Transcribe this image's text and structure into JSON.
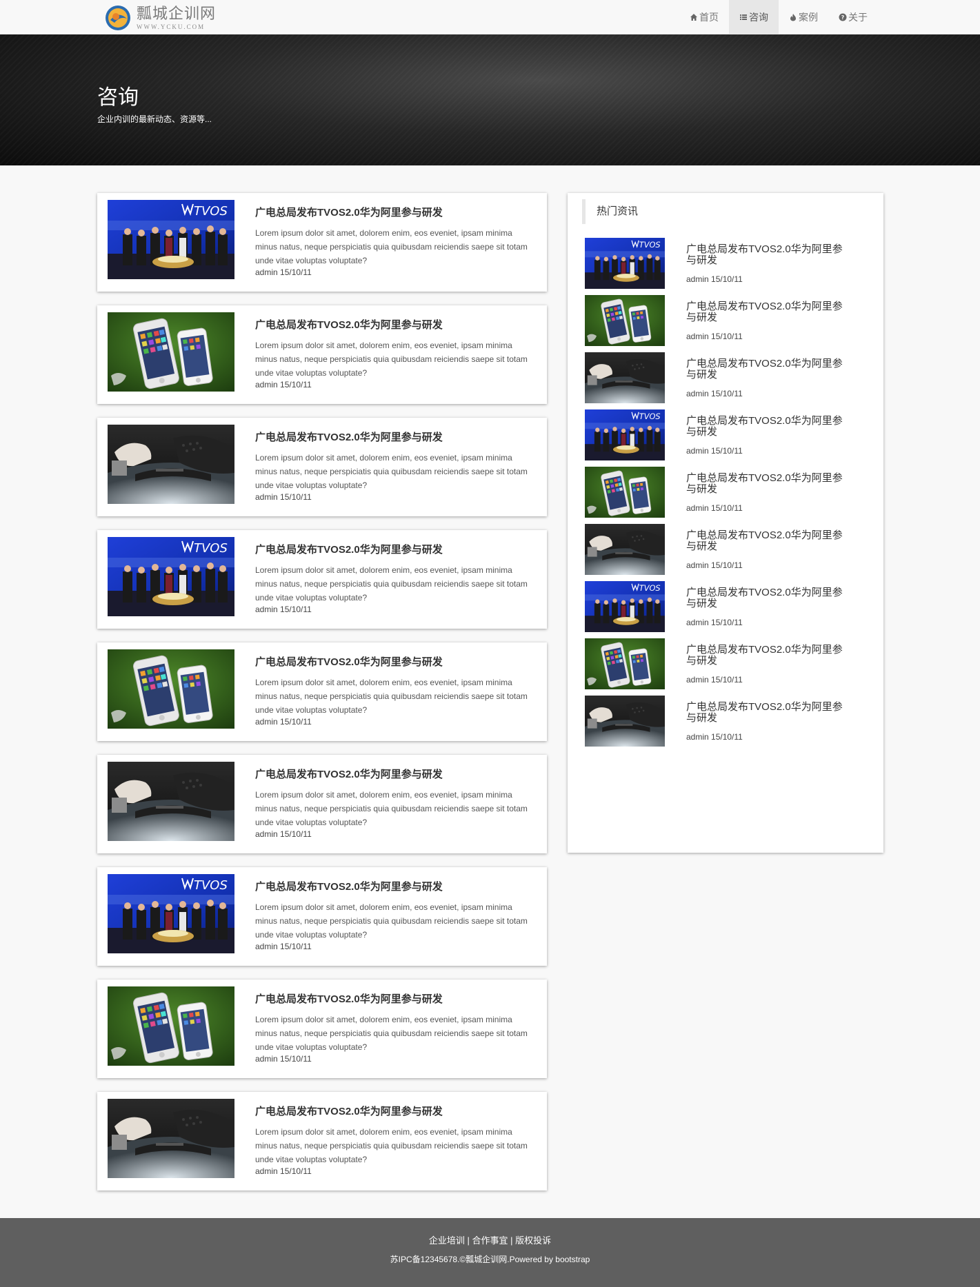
{
  "brand": {
    "title": "瓢城企训网",
    "subtitle": "WWW.YCKU.COM"
  },
  "nav": [
    {
      "label": "首页",
      "icon": "home-icon",
      "active": false
    },
    {
      "label": "咨询",
      "icon": "list-icon",
      "active": true
    },
    {
      "label": "案例",
      "icon": "fire-icon",
      "active": false
    },
    {
      "label": "关于",
      "icon": "question-circle-icon",
      "active": false
    }
  ],
  "hero": {
    "title": "咨询",
    "subtitle": "企业内训的最新动态、资源等..."
  },
  "articles": [
    {
      "title": "广电总局发布TVOS2.0华为阿里参与研发",
      "excerpt": "Lorem ipsum dolor sit amet, dolorem enim, eos eveniet, ipsam minima minus natus, neque perspiciatis quia quibusdam reiciendis saepe sit totam unde vitae voluptas voluptate?",
      "meta": "admin 15/10/11",
      "image": "tvos-event-photo"
    },
    {
      "title": "广电总局发布TVOS2.0华为阿里参与研发",
      "excerpt": "Lorem ipsum dolor sit amet, dolorem enim, eos eveniet, ipsam minima minus natus, neque perspiciatis quia quibusdam reiciendis saepe sit totam unde vitae voluptas voluptate?",
      "meta": "admin 15/10/11",
      "image": "iphones-on-grass-photo"
    },
    {
      "title": "广电总局发布TVOS2.0华为阿里参与研发",
      "excerpt": "Lorem ipsum dolor sit amet, dolorem enim, eos eveniet, ipsam minima minus natus, neque perspiciatis quia quibusdam reiciendis saepe sit totam unde vitae voluptas voluptate?",
      "meta": "admin 15/10/11",
      "image": "hands-on-device-photo"
    },
    {
      "title": "广电总局发布TVOS2.0华为阿里参与研发",
      "excerpt": "Lorem ipsum dolor sit amet, dolorem enim, eos eveniet, ipsam minima minus natus, neque perspiciatis quia quibusdam reiciendis saepe sit totam unde vitae voluptas voluptate?",
      "meta": "admin 15/10/11",
      "image": "tvos-event-photo"
    },
    {
      "title": "广电总局发布TVOS2.0华为阿里参与研发",
      "excerpt": "Lorem ipsum dolor sit amet, dolorem enim, eos eveniet, ipsam minima minus natus, neque perspiciatis quia quibusdam reiciendis saepe sit totam unde vitae voluptas voluptate?",
      "meta": "admin 15/10/11",
      "image": "iphones-on-grass-photo"
    },
    {
      "title": "广电总局发布TVOS2.0华为阿里参与研发",
      "excerpt": "Lorem ipsum dolor sit amet, dolorem enim, eos eveniet, ipsam minima minus natus, neque perspiciatis quia quibusdam reiciendis saepe sit totam unde vitae voluptas voluptate?",
      "meta": "admin 15/10/11",
      "image": "hands-on-device-photo"
    },
    {
      "title": "广电总局发布TVOS2.0华为阿里参与研发",
      "excerpt": "Lorem ipsum dolor sit amet, dolorem enim, eos eveniet, ipsam minima minus natus, neque perspiciatis quia quibusdam reiciendis saepe sit totam unde vitae voluptas voluptate?",
      "meta": "admin 15/10/11",
      "image": "tvos-event-photo"
    },
    {
      "title": "广电总局发布TVOS2.0华为阿里参与研发",
      "excerpt": "Lorem ipsum dolor sit amet, dolorem enim, eos eveniet, ipsam minima minus natus, neque perspiciatis quia quibusdam reiciendis saepe sit totam unde vitae voluptas voluptate?",
      "meta": "admin 15/10/11",
      "image": "iphones-on-grass-photo"
    },
    {
      "title": "广电总局发布TVOS2.0华为阿里参与研发",
      "excerpt": "Lorem ipsum dolor sit amet, dolorem enim, eos eveniet, ipsam minima minus natus, neque perspiciatis quia quibusdam reiciendis saepe sit totam unde vitae voluptas voluptate?",
      "meta": "admin 15/10/11",
      "image": "hands-on-device-photo"
    }
  ],
  "sidebar": {
    "heading": "热门资讯",
    "items": [
      {
        "title": "广电总局发布TVOS2.0华为阿里参与研发",
        "meta": "admin 15/10/11",
        "image": "tvos-event-photo"
      },
      {
        "title": "广电总局发布TVOS2.0华为阿里参与研发",
        "meta": "admin 15/10/11",
        "image": "iphones-on-grass-photo"
      },
      {
        "title": "广电总局发布TVOS2.0华为阿里参与研发",
        "meta": "admin 15/10/11",
        "image": "hands-on-device-photo"
      },
      {
        "title": "广电总局发布TVOS2.0华为阿里参与研发",
        "meta": "admin 15/10/11",
        "image": "tvos-event-photo"
      },
      {
        "title": "广电总局发布TVOS2.0华为阿里参与研发",
        "meta": "admin 15/10/11",
        "image": "iphones-on-grass-photo"
      },
      {
        "title": "广电总局发布TVOS2.0华为阿里参与研发",
        "meta": "admin 15/10/11",
        "image": "hands-on-device-photo"
      },
      {
        "title": "广电总局发布TVOS2.0华为阿里参与研发",
        "meta": "admin 15/10/11",
        "image": "tvos-event-photo"
      },
      {
        "title": "广电总局发布TVOS2.0华为阿里参与研发",
        "meta": "admin 15/10/11",
        "image": "iphones-on-grass-photo"
      },
      {
        "title": "广电总局发布TVOS2.0华为阿里参与研发",
        "meta": "admin 15/10/11",
        "image": "hands-on-device-photo"
      }
    ]
  },
  "footer": {
    "links": [
      "企业培训",
      "合作事宜",
      "版权投诉"
    ],
    "separator": " | ",
    "copyright": "苏IPC备12345678.©瓢城企训网.Powered by bootstrap"
  },
  "colors": {
    "page_bg": "#f8f8f8",
    "nav_active_bg": "#e7e7e7",
    "hero_bg": "#1a1a1a",
    "footer_bg": "#5f5f5f",
    "text": "#333333"
  }
}
